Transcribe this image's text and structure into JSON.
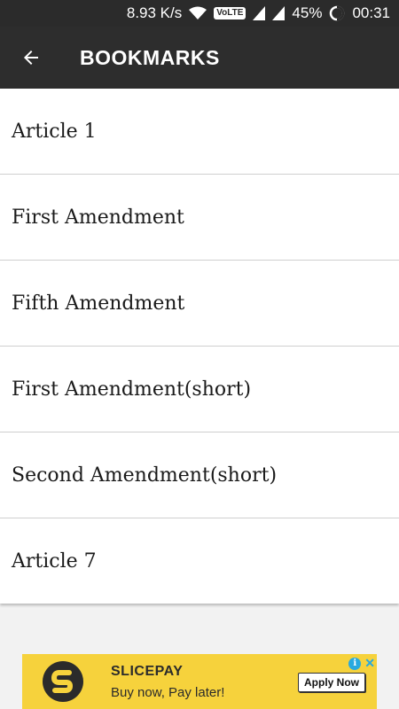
{
  "status_bar": {
    "network_speed": "8.93 K/s",
    "volte_label": "VoLTE",
    "battery_percent": "45%",
    "time": "00:31",
    "icons": [
      "wifi-icon",
      "signal-icon",
      "signal-icon",
      "battery-icon"
    ]
  },
  "app_bar": {
    "title": "BOOKMARKS",
    "back_icon": "arrow-left-icon"
  },
  "bookmarks": [
    {
      "label": "Article 1"
    },
    {
      "label": "First Amendment"
    },
    {
      "label": "Fifth Amendment"
    },
    {
      "label": "First Amendment(short)"
    },
    {
      "label": "Second Amendment(short)"
    },
    {
      "label": "Article 7"
    }
  ],
  "ad": {
    "brand": "SLICEPAY",
    "tagline": "Buy now, Pay later!",
    "cta": "Apply Now",
    "colors": {
      "background": "#f6d23c",
      "logo": "#2b2b2b",
      "choices": "#28a9e0"
    }
  },
  "colors": {
    "app_bar": "#2d2d2d",
    "status_bar": "#2b2b2b",
    "page_bg": "#f2f2f2"
  }
}
